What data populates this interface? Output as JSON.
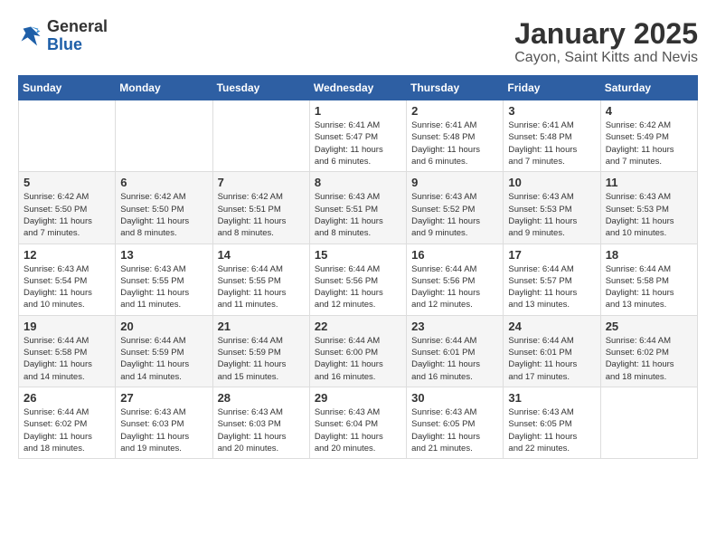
{
  "header": {
    "logo_general": "General",
    "logo_blue": "Blue",
    "month_title": "January 2025",
    "location": "Cayon, Saint Kitts and Nevis"
  },
  "weekdays": [
    "Sunday",
    "Monday",
    "Tuesday",
    "Wednesday",
    "Thursday",
    "Friday",
    "Saturday"
  ],
  "weeks": [
    [
      {
        "day": "",
        "detail": ""
      },
      {
        "day": "",
        "detail": ""
      },
      {
        "day": "",
        "detail": ""
      },
      {
        "day": "1",
        "detail": "Sunrise: 6:41 AM\nSunset: 5:47 PM\nDaylight: 11 hours\nand 6 minutes."
      },
      {
        "day": "2",
        "detail": "Sunrise: 6:41 AM\nSunset: 5:48 PM\nDaylight: 11 hours\nand 6 minutes."
      },
      {
        "day": "3",
        "detail": "Sunrise: 6:41 AM\nSunset: 5:48 PM\nDaylight: 11 hours\nand 7 minutes."
      },
      {
        "day": "4",
        "detail": "Sunrise: 6:42 AM\nSunset: 5:49 PM\nDaylight: 11 hours\nand 7 minutes."
      }
    ],
    [
      {
        "day": "5",
        "detail": "Sunrise: 6:42 AM\nSunset: 5:50 PM\nDaylight: 11 hours\nand 7 minutes."
      },
      {
        "day": "6",
        "detail": "Sunrise: 6:42 AM\nSunset: 5:50 PM\nDaylight: 11 hours\nand 8 minutes."
      },
      {
        "day": "7",
        "detail": "Sunrise: 6:42 AM\nSunset: 5:51 PM\nDaylight: 11 hours\nand 8 minutes."
      },
      {
        "day": "8",
        "detail": "Sunrise: 6:43 AM\nSunset: 5:51 PM\nDaylight: 11 hours\nand 8 minutes."
      },
      {
        "day": "9",
        "detail": "Sunrise: 6:43 AM\nSunset: 5:52 PM\nDaylight: 11 hours\nand 9 minutes."
      },
      {
        "day": "10",
        "detail": "Sunrise: 6:43 AM\nSunset: 5:53 PM\nDaylight: 11 hours\nand 9 minutes."
      },
      {
        "day": "11",
        "detail": "Sunrise: 6:43 AM\nSunset: 5:53 PM\nDaylight: 11 hours\nand 10 minutes."
      }
    ],
    [
      {
        "day": "12",
        "detail": "Sunrise: 6:43 AM\nSunset: 5:54 PM\nDaylight: 11 hours\nand 10 minutes."
      },
      {
        "day": "13",
        "detail": "Sunrise: 6:43 AM\nSunset: 5:55 PM\nDaylight: 11 hours\nand 11 minutes."
      },
      {
        "day": "14",
        "detail": "Sunrise: 6:44 AM\nSunset: 5:55 PM\nDaylight: 11 hours\nand 11 minutes."
      },
      {
        "day": "15",
        "detail": "Sunrise: 6:44 AM\nSunset: 5:56 PM\nDaylight: 11 hours\nand 12 minutes."
      },
      {
        "day": "16",
        "detail": "Sunrise: 6:44 AM\nSunset: 5:56 PM\nDaylight: 11 hours\nand 12 minutes."
      },
      {
        "day": "17",
        "detail": "Sunrise: 6:44 AM\nSunset: 5:57 PM\nDaylight: 11 hours\nand 13 minutes."
      },
      {
        "day": "18",
        "detail": "Sunrise: 6:44 AM\nSunset: 5:58 PM\nDaylight: 11 hours\nand 13 minutes."
      }
    ],
    [
      {
        "day": "19",
        "detail": "Sunrise: 6:44 AM\nSunset: 5:58 PM\nDaylight: 11 hours\nand 14 minutes."
      },
      {
        "day": "20",
        "detail": "Sunrise: 6:44 AM\nSunset: 5:59 PM\nDaylight: 11 hours\nand 14 minutes."
      },
      {
        "day": "21",
        "detail": "Sunrise: 6:44 AM\nSunset: 5:59 PM\nDaylight: 11 hours\nand 15 minutes."
      },
      {
        "day": "22",
        "detail": "Sunrise: 6:44 AM\nSunset: 6:00 PM\nDaylight: 11 hours\nand 16 minutes."
      },
      {
        "day": "23",
        "detail": "Sunrise: 6:44 AM\nSunset: 6:01 PM\nDaylight: 11 hours\nand 16 minutes."
      },
      {
        "day": "24",
        "detail": "Sunrise: 6:44 AM\nSunset: 6:01 PM\nDaylight: 11 hours\nand 17 minutes."
      },
      {
        "day": "25",
        "detail": "Sunrise: 6:44 AM\nSunset: 6:02 PM\nDaylight: 11 hours\nand 18 minutes."
      }
    ],
    [
      {
        "day": "26",
        "detail": "Sunrise: 6:44 AM\nSunset: 6:02 PM\nDaylight: 11 hours\nand 18 minutes."
      },
      {
        "day": "27",
        "detail": "Sunrise: 6:43 AM\nSunset: 6:03 PM\nDaylight: 11 hours\nand 19 minutes."
      },
      {
        "day": "28",
        "detail": "Sunrise: 6:43 AM\nSunset: 6:03 PM\nDaylight: 11 hours\nand 20 minutes."
      },
      {
        "day": "29",
        "detail": "Sunrise: 6:43 AM\nSunset: 6:04 PM\nDaylight: 11 hours\nand 20 minutes."
      },
      {
        "day": "30",
        "detail": "Sunrise: 6:43 AM\nSunset: 6:05 PM\nDaylight: 11 hours\nand 21 minutes."
      },
      {
        "day": "31",
        "detail": "Sunrise: 6:43 AM\nSunset: 6:05 PM\nDaylight: 11 hours\nand 22 minutes."
      },
      {
        "day": "",
        "detail": ""
      }
    ]
  ]
}
